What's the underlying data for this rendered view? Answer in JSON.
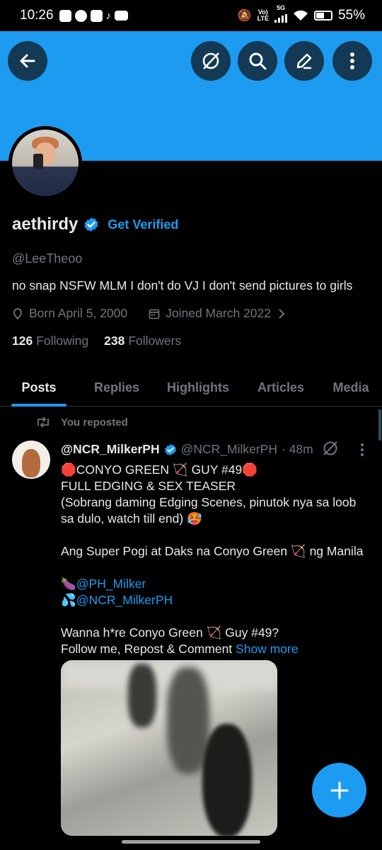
{
  "status_bar": {
    "time": "10:26",
    "network_top": "Vo)",
    "network_bottom": "LTE",
    "network_5g": "5G",
    "battery": "55%"
  },
  "profile": {
    "display_name": "aethirdy",
    "get_verified": "Get Verified",
    "handle": "@LeeTheoo",
    "bio": "no snap NSFW MLM I don't do VJ I don't send pictures to girls",
    "born": "Born April 5, 2000",
    "joined": "Joined March 2022",
    "following_count": "126",
    "following_label": "Following",
    "followers_count": "238",
    "followers_label": "Followers"
  },
  "tabs": [
    "Posts",
    "Replies",
    "Highlights",
    "Articles",
    "Media"
  ],
  "active_tab": "Posts",
  "post": {
    "repost_label": "You reposted",
    "author_name": "@NCR_MilkerPH",
    "author_handle": "@NCR_MilkerPH",
    "time": "· 48m",
    "lines": [
      "🛑CONYO GREEN 🏹 GUY #49🛑",
      "FULL EDGING & SEX TEASER",
      "(Sobrang daming Edging Scenes, pinutok nya sa loob",
      "sa dulo, watch till end) 🥵",
      "",
      "Ang Super Pogi at Daks na Conyo Green 🏹 ng Manila",
      ""
    ],
    "mention1_prefix": "🍆",
    "mention1": "@PH_Milker",
    "mention2_prefix": "💦",
    "mention2": "@NCR_MilkerPH",
    "line_after": "Wanna h*re Conyo Green 🏹 Guy #49?",
    "last_line": "Follow me, Repost & Comment",
    "show_more": "Show more"
  },
  "colors": {
    "accent": "#1d9bf0",
    "background": "#000000",
    "muted": "#71767b",
    "text": "#e7e9ea"
  }
}
